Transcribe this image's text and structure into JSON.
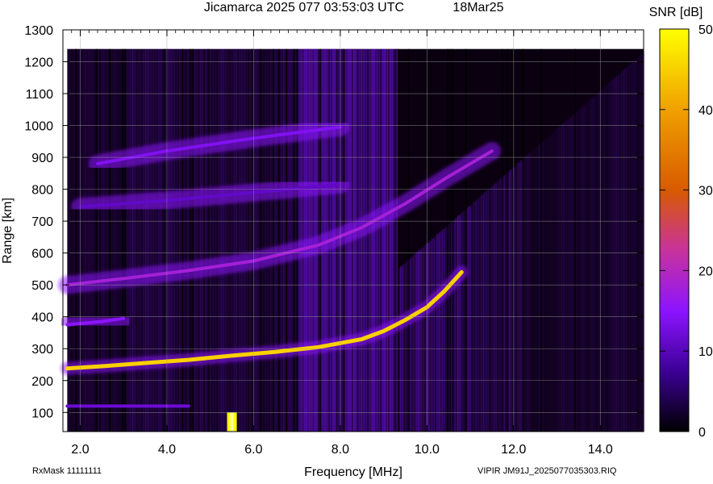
{
  "header": {
    "title": "Jicamarca 2025 077 03:53:03 UTC",
    "date": "18Mar25"
  },
  "footer": {
    "rxmask": "RxMask 11111111",
    "filename": "VIPIR  JM91J_2025077035303.RIQ"
  },
  "colorbar": {
    "label": "SNR [dB]",
    "ticks": [
      0,
      10,
      20,
      30,
      40,
      50
    ],
    "tick_labels": [
      "0",
      "10",
      "20",
      "30",
      "40",
      "50"
    ],
    "colors": [
      "#000000",
      "#3c0096",
      "#8c14ff",
      "#c8329c",
      "#d85a00",
      "#f0a000",
      "#ffff00"
    ]
  },
  "chart_data": {
    "type": "heatmap",
    "title": "Jicamarca 2025 077 03:53:03 UTC",
    "xlabel": "Frequency [MHz]",
    "ylabel": "Range [km]",
    "xlim": [
      1.6,
      15.0
    ],
    "ylim": [
      40,
      1300
    ],
    "x_ticks": [
      2,
      4,
      6,
      8,
      10,
      12,
      14
    ],
    "x_tick_labels": [
      "2.0",
      "4.0",
      "6.0",
      "8.0",
      "10.0",
      "12.0",
      "14.0"
    ],
    "y_ticks": [
      100,
      200,
      300,
      400,
      500,
      600,
      700,
      800,
      900,
      1000,
      1100,
      1200,
      1300
    ],
    "y_tick_labels": [
      "100",
      "200",
      "300",
      "400",
      "500",
      "600",
      "700",
      "800",
      "900",
      "1000",
      "1100",
      "1200",
      "1300"
    ],
    "grid": true,
    "data_top_range_km": 1240,
    "traces": [
      {
        "freq": [
          1.7,
          2.5,
          3.5,
          4.5,
          5.5,
          6.5,
          7.5,
          8.5,
          9.0,
          9.5,
          10.0,
          10.4,
          10.8
        ],
        "range": [
          238,
          245,
          255,
          265,
          278,
          290,
          305,
          330,
          355,
          390,
          430,
          480,
          540
        ],
        "snr": 45
      },
      {
        "freq": [
          1.7,
          3.0,
          4.5,
          6.0,
          7.5,
          8.5,
          9.5,
          10.5,
          11.5
        ],
        "range": [
          500,
          520,
          545,
          575,
          625,
          680,
          755,
          840,
          920
        ],
        "snr": 18
      },
      {
        "freq": [
          1.7,
          2.5,
          3.0
        ],
        "range": [
          375,
          385,
          395
        ],
        "snr": 15
      },
      {
        "freq": [
          2.4,
          4.0,
          6.0,
          8.0
        ],
        "range": [
          880,
          920,
          960,
          995
        ],
        "snr": 14
      },
      {
        "freq": [
          2.0,
          4.0,
          6.0,
          8.0
        ],
        "range": [
          745,
          765,
          790,
          815
        ],
        "snr": 11
      },
      {
        "freq": [
          1.7,
          3.0,
          4.5
        ],
        "range": [
          120,
          120,
          120
        ],
        "snr": 12
      }
    ],
    "spot": {
      "freq": 5.5,
      "range_min": 40,
      "range_max": 100,
      "snr": 50
    }
  }
}
